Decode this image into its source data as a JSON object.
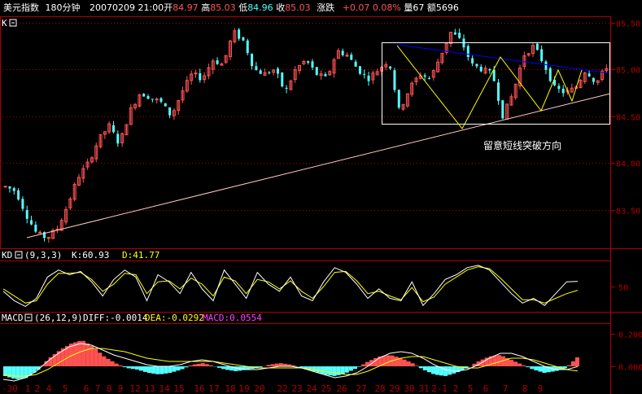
{
  "header": {
    "name": "美元指数",
    "period": "180分钟",
    "date_time": "20070209 21:00",
    "open_label": "开",
    "open": "84.97",
    "high_label": "高",
    "high": "85.03",
    "low_label": "低",
    "low": "84.96",
    "close_label": "收",
    "close": "85.03",
    "change_label": "涨跌",
    "change": "+0.07",
    "change_pct": "0.08%",
    "volume_label": "量",
    "volume": "67",
    "amount_label": "额",
    "amount": "5696"
  },
  "panes": {
    "main_label": "K",
    "kd_label": "KD",
    "kd_params": "(9,3,3)",
    "kd_k": "K:60.93",
    "kd_d": "D:41.77",
    "macd_label": "MACD",
    "macd_params": "(26,12,9)",
    "macd_diff": "DIFF:-0.0014",
    "macd_dea": "DEA:-0.0292",
    "macd_macd": "MACD:0.0554"
  },
  "annotation": "留意短线突破方向",
  "colors": {
    "up": "#ff5252",
    "down": "#54ffff",
    "frame": "#b00000",
    "k_line": "#ffffff",
    "d_line": "#ffff00",
    "trend_up": "#ffc8c8",
    "trend_down": "#0000ff",
    "zigzag": "#ffff00"
  },
  "chart_data": [
    {
      "type": "candlestick",
      "y_ticks": [
        "85.50",
        "85.00",
        "84.50",
        "84.00",
        "83.50"
      ],
      "ylim": [
        83.1,
        85.55
      ],
      "x_ticks": [
        "-30",
        "1",
        "2",
        "4",
        "5",
        "6",
        "7",
        "8",
        "9",
        "12",
        "13",
        "14",
        "15",
        "16",
        "17",
        "18",
        "19",
        "20",
        "22",
        "23",
        "24",
        "25",
        "26",
        "27",
        "28",
        "29",
        "30",
        "31",
        "2-1",
        "2",
        "5",
        "6",
        "7",
        "8",
        "9"
      ],
      "close_path": [
        83.75,
        83.7,
        83.45,
        83.25,
        83.2,
        83.3,
        83.55,
        83.85,
        84.0,
        84.25,
        84.4,
        84.2,
        84.55,
        84.75,
        84.7,
        84.65,
        84.5,
        84.75,
        84.95,
        84.9,
        85.1,
        85.05,
        85.4,
        85.3,
        85.0,
        84.95,
        85.0,
        84.75,
        85.0,
        85.1,
        84.95,
        84.9,
        85.2,
        85.15,
        85.0,
        84.9,
        85.0,
        85.1,
        84.55,
        84.8,
        84.95,
        84.9,
        85.15,
        85.4,
        85.3,
        85.05,
        85.0,
        84.95,
        84.5,
        84.75,
        85.15,
        85.25,
        85.05,
        84.8,
        84.75,
        84.8,
        85.0,
        84.85,
        85.03
      ]
    },
    {
      "type": "line",
      "title": "KD",
      "y_ticks": [
        "50"
      ],
      "ylim": [
        0,
        100
      ],
      "series": [
        {
          "name": "K",
          "values": [
            40,
            20,
            8,
            25,
            70,
            85,
            75,
            82,
            60,
            30,
            65,
            85,
            70,
            20,
            75,
            60,
            35,
            80,
            45,
            20,
            85,
            55,
            25,
            80,
            55,
            40,
            70,
            30,
            20,
            60,
            90,
            80,
            55,
            25,
            45,
            25,
            20,
            60,
            10,
            35,
            65,
            75,
            90,
            95,
            85,
            60,
            35,
            15,
            25,
            10,
            35,
            60,
            61
          ]
        },
        {
          "name": "D",
          "values": [
            45,
            30,
            15,
            20,
            55,
            78,
            78,
            80,
            65,
            40,
            55,
            78,
            75,
            35,
            60,
            62,
            45,
            68,
            55,
            30,
            70,
            62,
            35,
            65,
            60,
            45,
            62,
            40,
            25,
            50,
            80,
            82,
            62,
            35,
            40,
            30,
            22,
            48,
            18,
            28,
            55,
            70,
            85,
            92,
            88,
            68,
            45,
            22,
            22,
            15,
            25,
            35,
            42
          ]
        }
      ]
    },
    {
      "type": "bar",
      "title": "MACD",
      "y_ticks": [
        "0.200",
        "0.000"
      ],
      "ylim": [
        -0.1,
        0.25
      ],
      "series": [
        {
          "name": "MACD",
          "values": [
            -0.06,
            -0.08,
            -0.07,
            -0.02,
            0.05,
            0.1,
            0.14,
            0.16,
            0.12,
            0.06,
            0.02,
            -0.01,
            -0.02,
            -0.04,
            -0.05,
            -0.04,
            -0.02,
            0.01,
            0.02,
            0.0,
            -0.02,
            -0.03,
            -0.02,
            -0.01,
            0.01,
            0.02,
            0.01,
            -0.01,
            -0.03,
            -0.05,
            -0.06,
            -0.04,
            -0.01,
            0.03,
            0.06,
            0.07,
            0.05,
            0.02,
            -0.02,
            -0.05,
            -0.06,
            -0.04,
            -0.01,
            0.03,
            0.06,
            0.07,
            0.04,
            0.01,
            -0.02,
            -0.04,
            -0.03,
            -0.01,
            0.055
          ]
        },
        {
          "name": "DIFF",
          "values": [
            -0.08,
            -0.09,
            -0.07,
            -0.03,
            0.03,
            0.08,
            0.12,
            0.14,
            0.13,
            0.1,
            0.07,
            0.05,
            0.03,
            0.01,
            0.0,
            0.0,
            0.01,
            0.03,
            0.04,
            0.03,
            0.01,
            -0.01,
            -0.02,
            -0.02,
            -0.01,
            0.0,
            0.0,
            -0.01,
            -0.03,
            -0.05,
            -0.07,
            -0.06,
            -0.04,
            0.0,
            0.05,
            0.08,
            0.09,
            0.08,
            0.05,
            0.01,
            -0.02,
            -0.03,
            -0.02,
            0.01,
            0.05,
            0.08,
            0.08,
            0.06,
            0.03,
            0.0,
            -0.02,
            -0.02,
            -0.0014
          ]
        },
        {
          "name": "DEA",
          "values": [
            -0.05,
            -0.06,
            -0.06,
            -0.05,
            -0.02,
            0.02,
            0.06,
            0.09,
            0.11,
            0.11,
            0.1,
            0.09,
            0.07,
            0.05,
            0.04,
            0.03,
            0.03,
            0.03,
            0.03,
            0.03,
            0.02,
            0.01,
            0.0,
            -0.01,
            -0.01,
            -0.01,
            -0.01,
            -0.01,
            -0.02,
            -0.03,
            -0.04,
            -0.05,
            -0.05,
            -0.03,
            0.0,
            0.03,
            0.05,
            0.06,
            0.06,
            0.04,
            0.02,
            0.0,
            -0.01,
            -0.01,
            0.01,
            0.03,
            0.05,
            0.05,
            0.04,
            0.02,
            0.0,
            -0.02,
            -0.0292
          ]
        }
      ]
    }
  ]
}
